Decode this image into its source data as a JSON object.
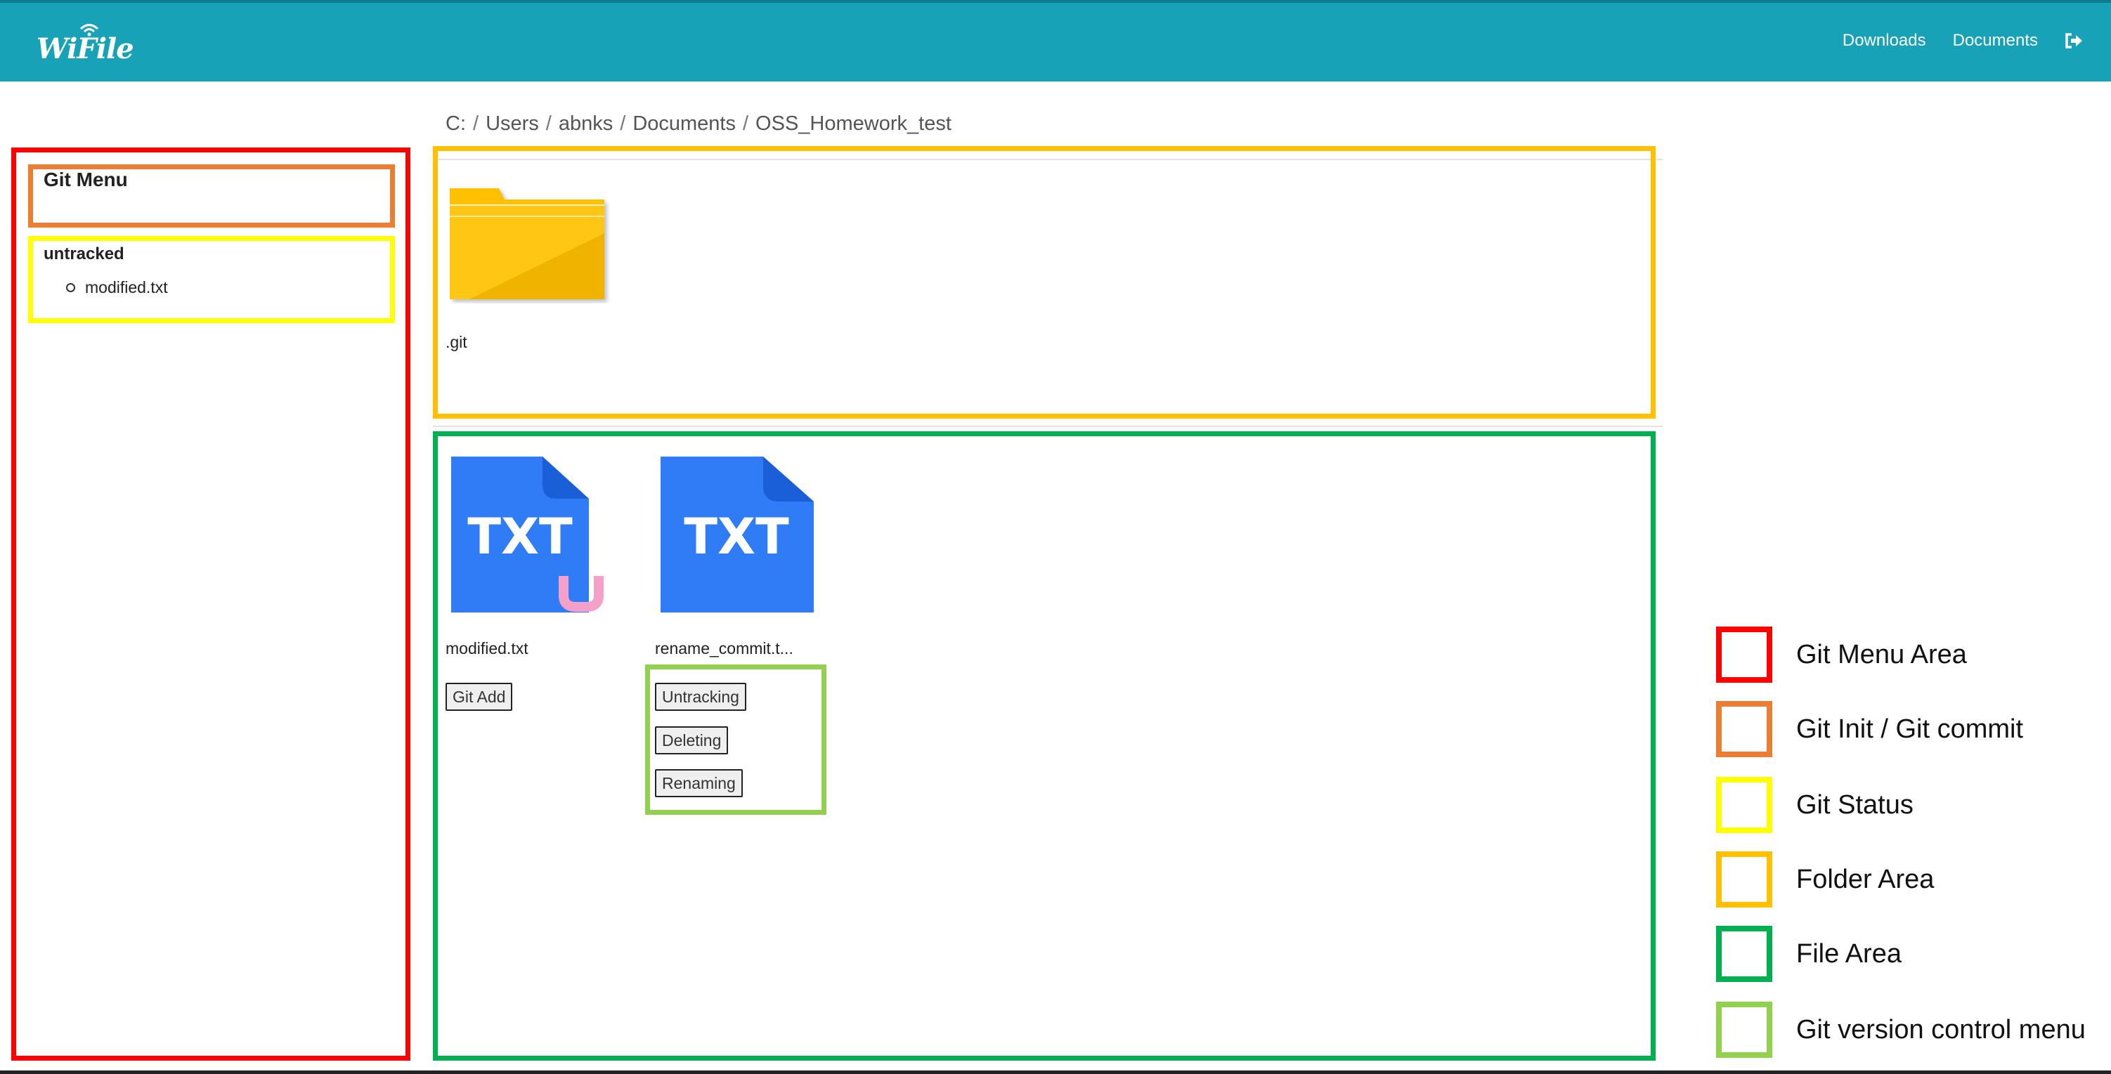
{
  "navbar": {
    "logo_text": "WiFile",
    "links": [
      "Downloads",
      "Documents"
    ],
    "logout_icon": "sign-out-icon"
  },
  "breadcrumb": [
    "C:",
    "Users",
    "abnks",
    "Documents",
    "OSS_Homework_test"
  ],
  "git_menu": {
    "title": "Git Menu",
    "status_heading": "untracked",
    "status_items": [
      "modified.txt"
    ]
  },
  "folders": [
    {
      "name": ".git",
      "icon": "folder-icon"
    }
  ],
  "files": [
    {
      "name": "modified.txt",
      "icon": "txt-file-icon",
      "badge": "U",
      "badge_color": "#f5a0c8",
      "buttons": [
        "Git Add"
      ]
    },
    {
      "name": "rename_commit.t...",
      "icon": "txt-file-icon",
      "buttons": [
        "Untracking",
        "Deleting",
        "Renaming"
      ]
    }
  ],
  "legend": [
    {
      "label": "Git Menu Area",
      "color": "#ff0000"
    },
    {
      "label": "Git Init / Git commit",
      "color": "#ed7d31"
    },
    {
      "label": "Git Status",
      "color": "#ffff00"
    },
    {
      "label": "Folder Area",
      "color": "#ffc000"
    },
    {
      "label": "File Area",
      "color": "#00b050"
    },
    {
      "label": "Git version control menu",
      "color": "#92d050"
    }
  ],
  "colors": {
    "navbar": "#17a2b8",
    "file_icon": "#2f7cf6",
    "folder_icon": "#ffc000"
  }
}
